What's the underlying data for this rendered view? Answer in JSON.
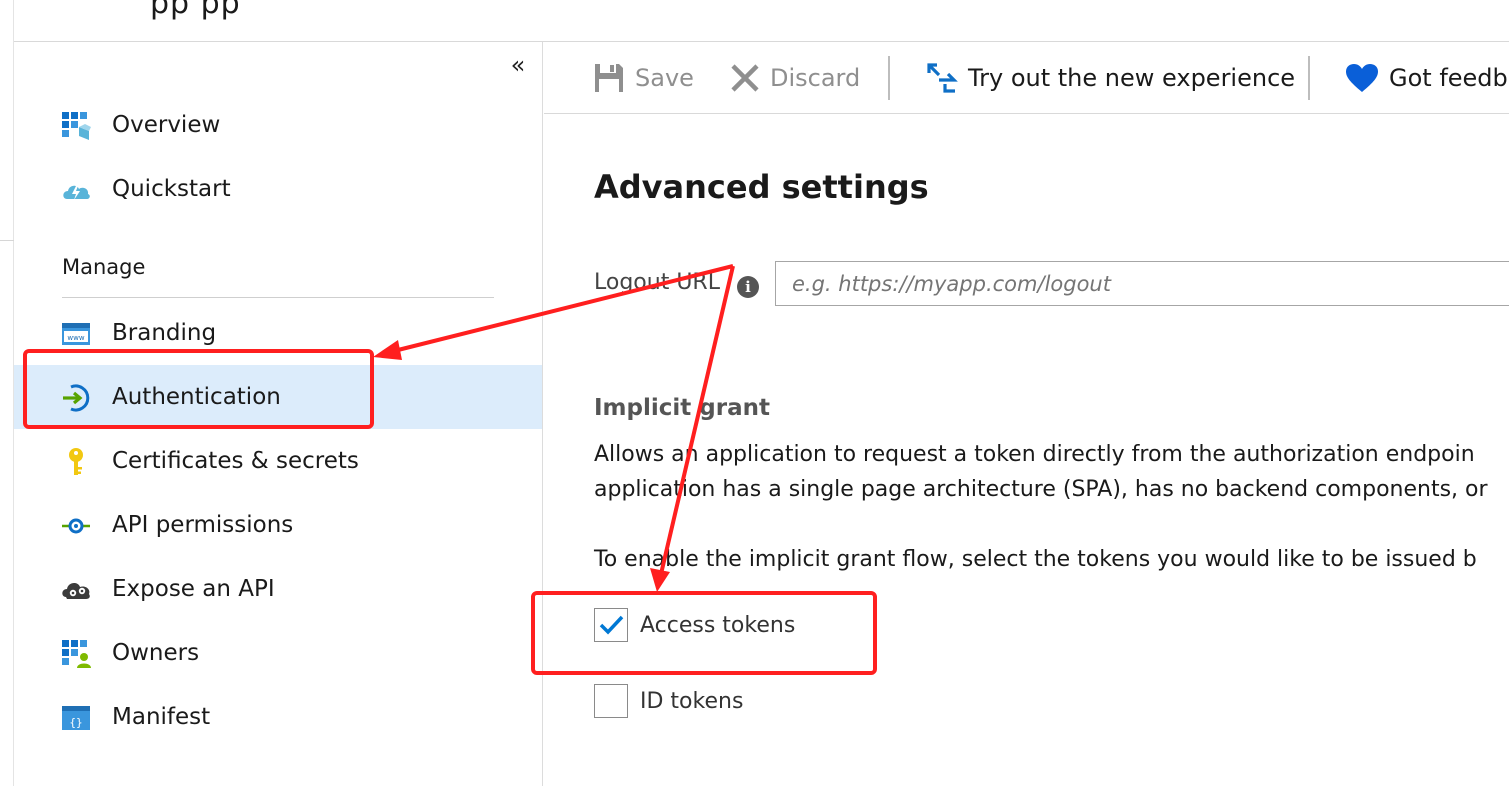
{
  "header": {
    "title_fragment": "pp  pp"
  },
  "sidebar": {
    "collapse_glyph": "«",
    "items": [
      {
        "label": "Overview",
        "icon": "overview-grid-icon"
      },
      {
        "label": "Quickstart",
        "icon": "quickstart-cloud-icon"
      },
      {
        "label": "Branding",
        "icon": "www-branding-icon"
      },
      {
        "label": "Authentication",
        "icon": "authentication-arrow-icon",
        "active": true
      },
      {
        "label": "Certificates & secrets",
        "icon": "key-icon"
      },
      {
        "label": "API permissions",
        "icon": "api-permissions-icon"
      },
      {
        "label": "Expose an API",
        "icon": "expose-api-gears-icon"
      },
      {
        "label": "Owners",
        "icon": "owners-icon"
      },
      {
        "label": "Manifest",
        "icon": "manifest-braces-icon"
      }
    ],
    "section_heading": "Manage"
  },
  "toolbar": {
    "save_label": "Save",
    "discard_label": "Discard",
    "try_label": "Try out the new experience",
    "feedback_label": "Got feedba"
  },
  "main": {
    "title": "Advanced settings",
    "logout_label": "Logout URL",
    "logout_placeholder": "e.g. https://myapp.com/logout",
    "implicit_heading": "Implicit grant",
    "para1_line1": "Allows an application to request a token directly from the authorization endpoin",
    "para1_line2": "application has a single page architecture (SPA), has no backend components, or",
    "para2": "To enable the implicit grant flow, select the tokens you would like to be issued b",
    "access_tokens_label": "Access tokens",
    "access_tokens_checked": true,
    "id_tokens_label": "ID tokens",
    "id_tokens_checked": false
  },
  "colors": {
    "accent": "#0078d4",
    "active_bg": "#dcecfb",
    "annotation": "#ff1f1f",
    "heart": "#0a5fd8"
  }
}
